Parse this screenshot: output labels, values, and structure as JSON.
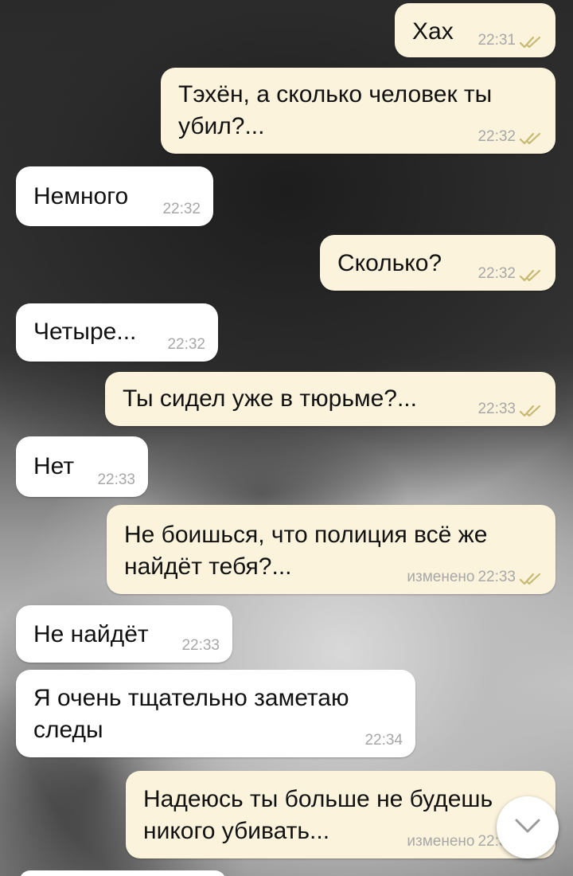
{
  "messages": [
    {
      "dir": "out",
      "text": [
        "Хах"
      ],
      "edited": "",
      "time": "22:31",
      "read": true
    },
    {
      "dir": "out",
      "text": [
        "Тэхён, а сколько человек ты",
        "убил?..."
      ],
      "edited": "",
      "time": "22:32",
      "read": true
    },
    {
      "dir": "in",
      "text": [
        "Немного"
      ],
      "edited": "",
      "time": "22:32",
      "read": false
    },
    {
      "dir": "out",
      "text": [
        "Сколько?"
      ],
      "edited": "",
      "time": "22:32",
      "read": true
    },
    {
      "dir": "in",
      "text": [
        "Четыре..."
      ],
      "edited": "",
      "time": "22:32",
      "read": false
    },
    {
      "dir": "out",
      "text": [
        "Ты сидел уже в тюрьме?..."
      ],
      "edited": "",
      "time": "22:33",
      "read": true
    },
    {
      "dir": "in",
      "text": [
        "Нет"
      ],
      "edited": "",
      "time": "22:33",
      "read": false
    },
    {
      "dir": "out",
      "text": [
        "Не боишься, что полиция всё же",
        "найдёт тебя?..."
      ],
      "edited": "изменено",
      "time": "22:33",
      "read": true
    },
    {
      "dir": "in",
      "text": [
        "Не найдёт"
      ],
      "edited": "",
      "time": "22:33",
      "read": false
    },
    {
      "dir": "in",
      "text": [
        "Я очень тщательно заметаю",
        "следы"
      ],
      "edited": "",
      "time": "22:34",
      "read": false
    },
    {
      "dir": "out",
      "text": [
        "Надеюсь ты больше не будешь",
        "никого убивать..."
      ],
      "edited": "изменено",
      "time": "22:34",
      "read": true
    }
  ],
  "icons": {
    "read_receipt": "double-check-icon",
    "scroll_down": "chevron-down-icon"
  },
  "colors": {
    "incoming_bubble": "#ffffff",
    "outgoing_bubble": "#fbf3dc",
    "read_tick": "#c7b870",
    "meta_text": "#a7a7a7"
  }
}
